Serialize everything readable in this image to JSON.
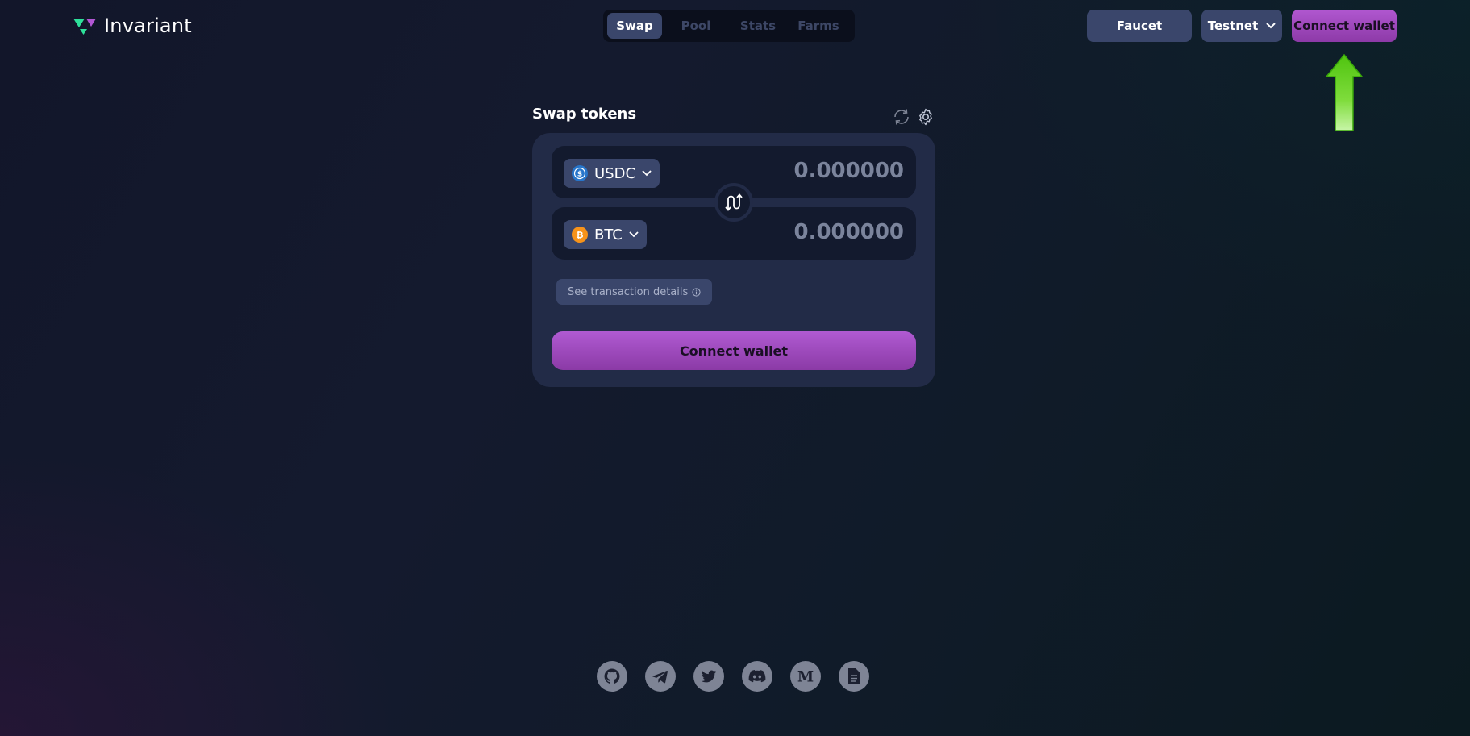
{
  "header": {
    "logo_text": "Invariant",
    "logo_icon": "invariant-logo-icon",
    "nav_tabs": [
      {
        "label": "Swap",
        "active": true
      },
      {
        "label": "Pool",
        "active": false
      },
      {
        "label": "Stats",
        "active": false
      },
      {
        "label": "Farms",
        "active": false
      }
    ],
    "faucet_label": "Faucet",
    "network_label": "Testnet",
    "connect_label": "Connect wallet"
  },
  "swap": {
    "title": "Swap tokens",
    "from": {
      "token": "USDC",
      "icon": "usdc-icon",
      "amount": "0.000000"
    },
    "to": {
      "token": "BTC",
      "icon": "btc-icon",
      "amount": "0.000000"
    },
    "details_label": "See transaction details",
    "connect_label": "Connect wallet"
  },
  "footer": {
    "socials": [
      "github-icon",
      "telegram-icon",
      "twitter-icon",
      "discord-icon",
      "medium-icon",
      "docs-icon"
    ]
  },
  "colors": {
    "accent": "#a64bc8",
    "panel": "#222b47",
    "input_bg": "#131a2e",
    "button_bg": "#3a466b",
    "highlight_arrow": "#5fd31a"
  }
}
